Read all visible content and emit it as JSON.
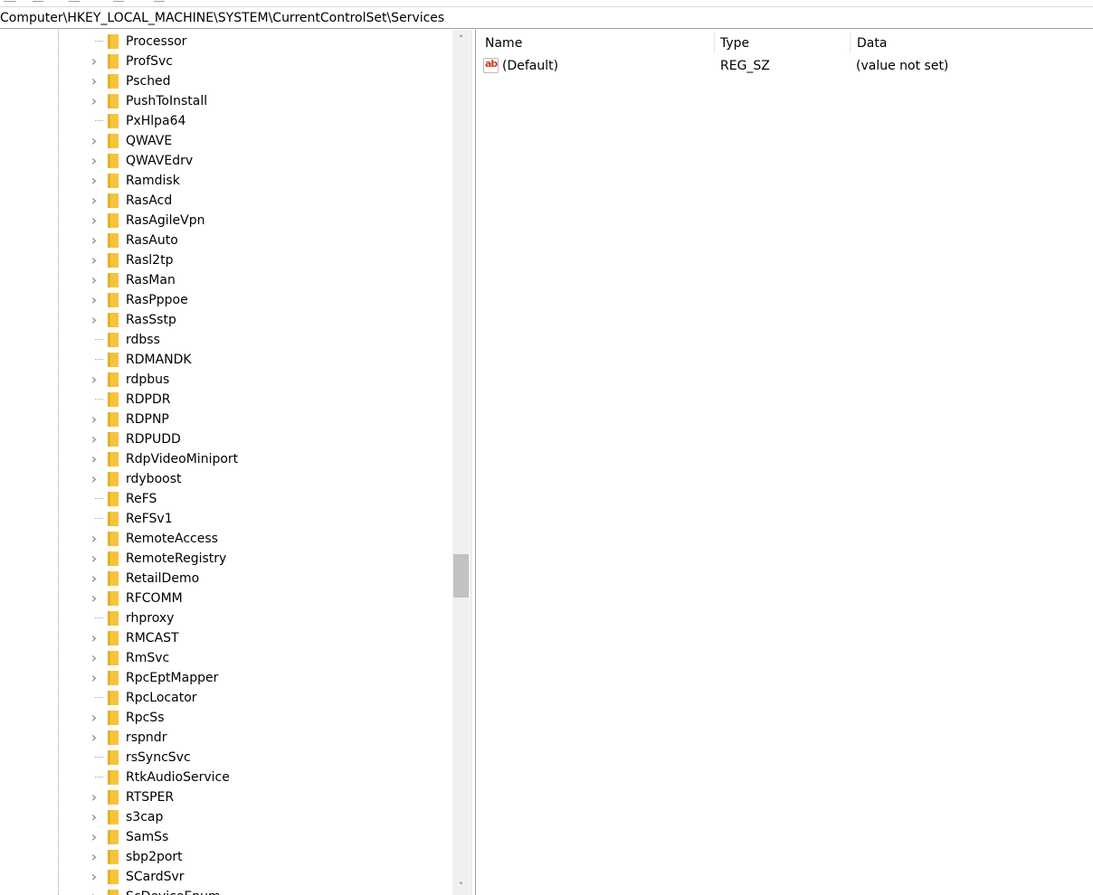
{
  "address": {
    "path": "Computer\\HKEY_LOCAL_MACHINE\\SYSTEM\\CurrentControlSet\\Services"
  },
  "tree": {
    "items": [
      {
        "label": "Processor",
        "expandable": false
      },
      {
        "label": "ProfSvc",
        "expandable": true
      },
      {
        "label": "Psched",
        "expandable": true
      },
      {
        "label": "PushToInstall",
        "expandable": true
      },
      {
        "label": "PxHlpa64",
        "expandable": false
      },
      {
        "label": "QWAVE",
        "expandable": true
      },
      {
        "label": "QWAVEdrv",
        "expandable": true
      },
      {
        "label": "Ramdisk",
        "expandable": true
      },
      {
        "label": "RasAcd",
        "expandable": true
      },
      {
        "label": "RasAgileVpn",
        "expandable": true
      },
      {
        "label": "RasAuto",
        "expandable": true
      },
      {
        "label": "Rasl2tp",
        "expandable": true
      },
      {
        "label": "RasMan",
        "expandable": true
      },
      {
        "label": "RasPppoe",
        "expandable": true
      },
      {
        "label": "RasSstp",
        "expandable": true
      },
      {
        "label": "rdbss",
        "expandable": false
      },
      {
        "label": "RDMANDK",
        "expandable": false
      },
      {
        "label": "rdpbus",
        "expandable": true
      },
      {
        "label": "RDPDR",
        "expandable": false
      },
      {
        "label": "RDPNP",
        "expandable": true
      },
      {
        "label": "RDPUDD",
        "expandable": true
      },
      {
        "label": "RdpVideoMiniport",
        "expandable": true
      },
      {
        "label": "rdyboost",
        "expandable": true
      },
      {
        "label": "ReFS",
        "expandable": false
      },
      {
        "label": "ReFSv1",
        "expandable": false
      },
      {
        "label": "RemoteAccess",
        "expandable": true
      },
      {
        "label": "RemoteRegistry",
        "expandable": true
      },
      {
        "label": "RetailDemo",
        "expandable": true
      },
      {
        "label": "RFCOMM",
        "expandable": true
      },
      {
        "label": "rhproxy",
        "expandable": false
      },
      {
        "label": "RMCAST",
        "expandable": true
      },
      {
        "label": "RmSvc",
        "expandable": true
      },
      {
        "label": "RpcEptMapper",
        "expandable": true
      },
      {
        "label": "RpcLocator",
        "expandable": false
      },
      {
        "label": "RpcSs",
        "expandable": true
      },
      {
        "label": "rspndr",
        "expandable": true
      },
      {
        "label": "rsSyncSvc",
        "expandable": false
      },
      {
        "label": "RtkAudioService",
        "expandable": false
      },
      {
        "label": "RTSPER",
        "expandable": true
      },
      {
        "label": "s3cap",
        "expandable": true
      },
      {
        "label": "SamSs",
        "expandable": true
      },
      {
        "label": "sbp2port",
        "expandable": true
      },
      {
        "label": "SCardSvr",
        "expandable": true
      },
      {
        "label": "ScDeviceEnum",
        "expandable": true
      }
    ]
  },
  "list": {
    "columns": {
      "name": "Name",
      "type": "Type",
      "data": "Data"
    },
    "rows": [
      {
        "icon": "string-value-icon",
        "icon_text": "ab",
        "name": "(Default)",
        "type": "REG_SZ",
        "data": "(value not set)"
      }
    ]
  },
  "colors": {
    "folder": "#f5c43e",
    "folder_tab": "#e8b023",
    "string_icon_text": "#d03a1a"
  }
}
